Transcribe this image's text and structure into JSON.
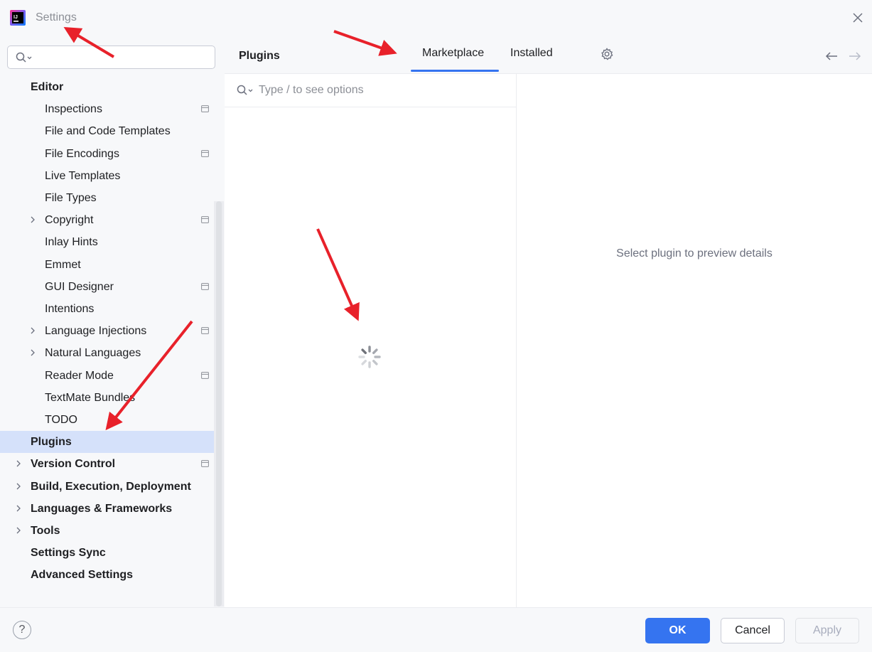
{
  "window": {
    "title": "Settings"
  },
  "icons": {
    "app": "intellij-idea-icon",
    "close": "close-icon",
    "search": "search-icon",
    "settings": "gear-icon",
    "back": "arrow-left-icon",
    "forward": "arrow-right-icon",
    "help": "help-icon",
    "spinner": "loading-spinner-icon"
  },
  "sidebar": {
    "search_placeholder": "",
    "items": [
      {
        "label": "Editor",
        "bold": true,
        "chevron": false,
        "project": false
      },
      {
        "label": "Inspections",
        "bold": false,
        "chevron": false,
        "project": true
      },
      {
        "label": "File and Code Templates",
        "bold": false,
        "chevron": false,
        "project": false
      },
      {
        "label": "File Encodings",
        "bold": false,
        "chevron": false,
        "project": true
      },
      {
        "label": "Live Templates",
        "bold": false,
        "chevron": false,
        "project": false
      },
      {
        "label": "File Types",
        "bold": false,
        "chevron": false,
        "project": false
      },
      {
        "label": "Copyright",
        "bold": false,
        "chevron": true,
        "project": true
      },
      {
        "label": "Inlay Hints",
        "bold": false,
        "chevron": false,
        "project": false
      },
      {
        "label": "Emmet",
        "bold": false,
        "chevron": false,
        "project": false
      },
      {
        "label": "GUI Designer",
        "bold": false,
        "chevron": false,
        "project": true
      },
      {
        "label": "Intentions",
        "bold": false,
        "chevron": false,
        "project": false
      },
      {
        "label": "Language Injections",
        "bold": false,
        "chevron": true,
        "project": true
      },
      {
        "label": "Natural Languages",
        "bold": false,
        "chevron": true,
        "project": false
      },
      {
        "label": "Reader Mode",
        "bold": false,
        "chevron": false,
        "project": true
      },
      {
        "label": "TextMate Bundles",
        "bold": false,
        "chevron": false,
        "project": false
      },
      {
        "label": "TODO",
        "bold": false,
        "chevron": false,
        "project": false
      },
      {
        "label": "Plugins",
        "bold": true,
        "chevron": false,
        "project": false,
        "selected": true
      },
      {
        "label": "Version Control",
        "bold": true,
        "chevron": true,
        "project": true
      },
      {
        "label": "Build, Execution, Deployment",
        "bold": true,
        "chevron": true,
        "project": false
      },
      {
        "label": "Languages & Frameworks",
        "bold": true,
        "chevron": true,
        "project": false
      },
      {
        "label": "Tools",
        "bold": true,
        "chevron": true,
        "project": false
      },
      {
        "label": "Settings Sync",
        "bold": true,
        "chevron": false,
        "project": false
      },
      {
        "label": "Advanced Settings",
        "bold": true,
        "chevron": false,
        "project": false
      }
    ]
  },
  "main": {
    "title": "Plugins",
    "tabs": [
      {
        "label": "Marketplace",
        "active": true
      },
      {
        "label": "Installed",
        "active": false
      }
    ],
    "search_placeholder": "Type / to see options",
    "preview_empty": "Select plugin to preview details"
  },
  "footer": {
    "help_label": "?",
    "ok_label": "OK",
    "cancel_label": "Cancel",
    "apply_label": "Apply"
  },
  "colors": {
    "accent": "#3574f0",
    "selection": "#d5e1fa",
    "annotation_arrow": "#e8212a"
  }
}
